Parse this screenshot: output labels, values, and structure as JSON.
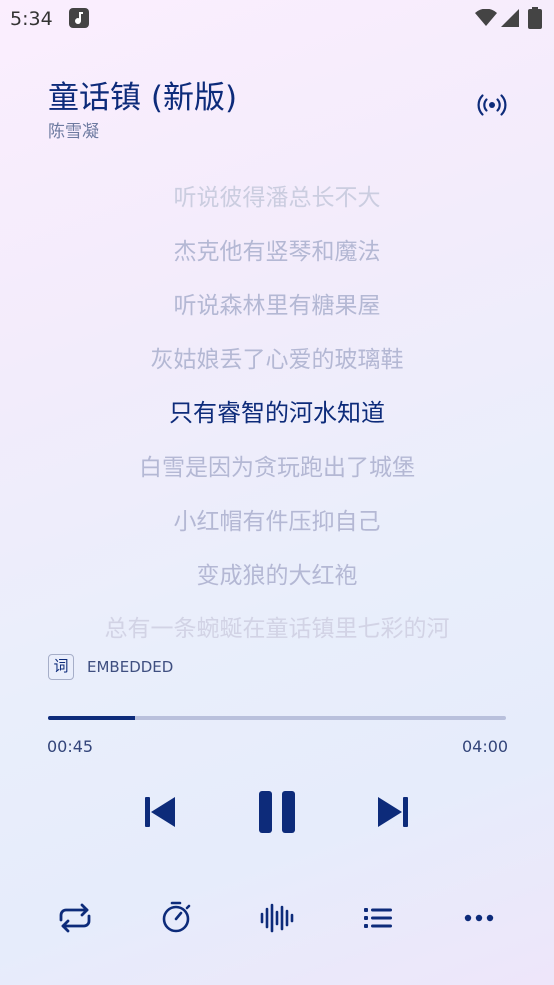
{
  "status_bar": {
    "time": "5:34"
  },
  "now_playing": {
    "title": "童话镇 (新版)",
    "artist": "陈雪凝"
  },
  "lyrics": [
    "听说彼得潘总长不大",
    "杰克他有竖琴和魔法",
    "听说森林里有糖果屋",
    "灰姑娘丢了心爱的玻璃鞋",
    "只有睿智的河水知道",
    "白雪是因为贪玩跑出了城堡",
    "小红帽有件压抑自己",
    "变成狼的大红袍",
    "总有一条蜿蜒在童话镇里七彩的河"
  ],
  "lyric_source": {
    "badge": "词",
    "label": "EMBEDDED"
  },
  "playback": {
    "elapsed": "00:45",
    "total": "04:00",
    "progress": 0.19
  },
  "colors": {
    "accent": "#0d2b7a",
    "inactive_lyric": "#b4b8d4"
  },
  "icons": {
    "cast": "cast-icon",
    "prev": "skip-previous-icon",
    "pause": "pause-icon",
    "next": "skip-next-icon",
    "repeat": "repeat-icon",
    "timer": "timer-icon",
    "equalizer": "audio-waveform-icon",
    "queue": "queue-list-icon",
    "more": "more-horizontal-icon"
  }
}
